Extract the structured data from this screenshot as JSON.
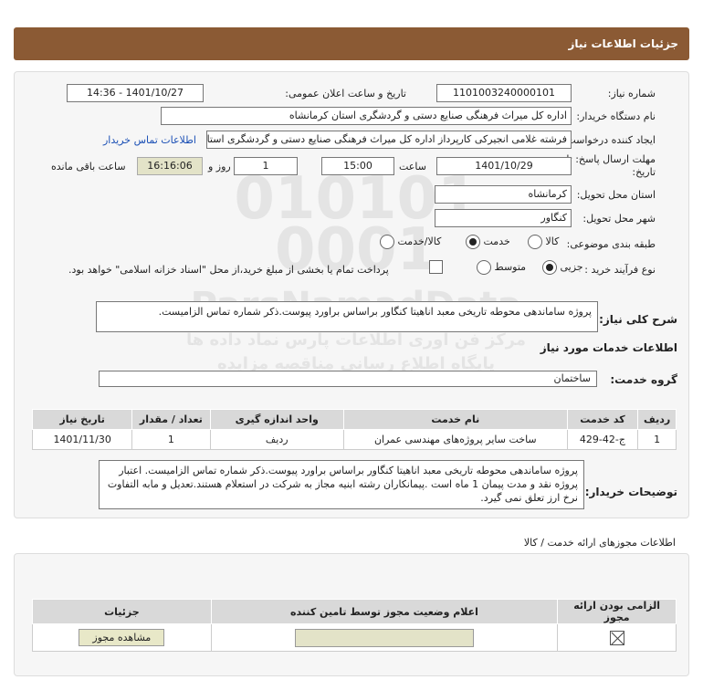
{
  "header": {
    "title": "جزئیات اطلاعات نیاز"
  },
  "fields": {
    "need_number_label": "شماره نیاز:",
    "need_number": "1101003240000101",
    "announce_label": "تاریخ و ساعت اعلان عمومی:",
    "announce_value": "1401/10/27 - 14:36",
    "buyer_label": "نام دستگاه خریدار:",
    "buyer_value": "اداره کل میراث فرهنگی  صنایع دستی و گردشگری استان کرمانشاه",
    "creator_label": "ایجاد کننده درخواست:",
    "creator_value": "فرشته غلامی انجیرکی کارپرداز اداره کل میراث فرهنگی  صنایع دستی و گردشگری استان کرمانشاه",
    "contact_link": "اطلاعات تماس خریدار",
    "deadline_label_1": "مهلت ارسال پاسخ: تا",
    "deadline_label_2": "تاریخ:",
    "deadline_date": "1401/10/29",
    "time_label": "ساعت",
    "deadline_time": "15:00",
    "days_value": "1",
    "days_label": "روز و",
    "remaining_time": "16:16:06",
    "remaining_label": "ساعت باقی مانده",
    "province_label": "استان محل تحویل:",
    "province_value": "کرمانشاه",
    "city_label": "شهر محل تحویل:",
    "city_value": "کنگاور",
    "category_label": "طبقه بندی موضوعی:",
    "category_options": [
      "کالا",
      "خدمت",
      "کالا/خدمت"
    ],
    "category_selected": "خدمت",
    "process_label": "نوع فرآیند خرید :",
    "process_options": [
      "جزیی",
      "متوسط"
    ],
    "process_selected": "جزیی",
    "payment_note": "پرداخت تمام یا بخشی از مبلغ خرید،از محل \"اسناد خزانه اسلامی\" خواهد بود."
  },
  "description": {
    "label": "شرح کلی نیاز:",
    "text": "پروژه ساماندهی محوطه تاریخی معبد اناهیتا کنگاور براساس براورد پیوست.ذکر شماره تماس الزامیست."
  },
  "services": {
    "section_title": "اطلاعات خدمات مورد نیاز",
    "group_label": "گروه خدمت:",
    "group_value": "ساختمان",
    "columns": [
      "ردیف",
      "کد خدمت",
      "نام خدمت",
      "واحد اندازه گیری",
      "تعداد / مقدار",
      "تاریخ نیاز"
    ],
    "rows": [
      [
        "1",
        "ج-42-429",
        "ساخت سایر پروژه‌های مهندسی عمران",
        "ردیف",
        "1",
        "1401/11/30"
      ]
    ]
  },
  "buyer_notes": {
    "label": "توضیحات خریدار:",
    "text": "پروژه ساماندهی محوطه تاریخی معبد اناهیتا کنگاور براساس براورد پیوست.ذکر شماره تماس الزامیست. اعتبار پروژه نقد و مدت پیمان 1 ماه است .پیمانکاران رشته ابنیه مجاز به شرکت در استعلام هستند.تعدیل و مابه التفاوت نرخ ارز تعلق نمی گیرد."
  },
  "permits": {
    "section_title": "اطلاعات مجوزهای ارائه خدمت / کالا",
    "columns": [
      "الزامی بودن ارائه مجوز",
      "اعلام وضعیت مجوز توسط تامین کننده",
      "جزئیات"
    ],
    "view_button": "مشاهده مجوز"
  },
  "watermark": {
    "line1": "010101",
    "line2": "0001",
    "line3": "ParsNamadData",
    "line4": "مرکز فن آوری اطلاعات پارس نماد داده ها",
    "line5": "پایگاه اطلاع رسانی مناقصه مزایده"
  }
}
